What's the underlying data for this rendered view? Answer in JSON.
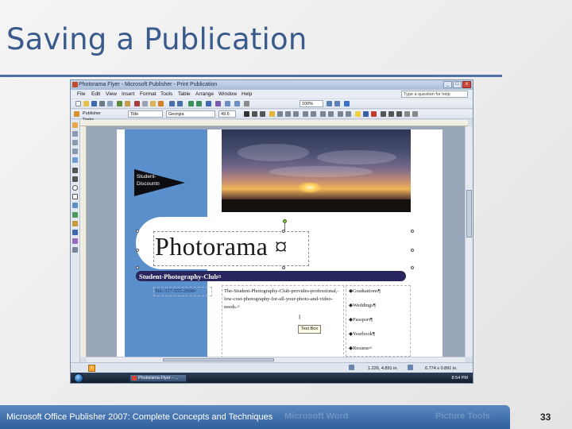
{
  "slide": {
    "title": "Saving a Publication",
    "footer": "Microsoft Office Publisher 2007: Complete Concepts and Techniques",
    "page_number": "33",
    "footer_ghost_1": "Microsoft Word",
    "footer_ghost_2": "Picture Tools"
  },
  "window": {
    "title": "Photorama Flyer - Microsoft Publisher - Print Publication",
    "minimize": "_",
    "maximize": "□",
    "close": "x"
  },
  "menu": [
    "File",
    "Edit",
    "View",
    "Insert",
    "Format",
    "Tools",
    "Table",
    "Arrange",
    "Window",
    "Help"
  ],
  "help_placeholder": "Type a question for help",
  "toolbar": {
    "zoom": "100%",
    "task_pane": "Publisher Tasks",
    "style": "Title",
    "font": "Georgia",
    "size": "49.6"
  },
  "publication": {
    "pennant_line1": "Student-",
    "pennant_line2": "Discount¤",
    "logo": "Photorama ¤",
    "club": "Student-Photography-Club¤",
    "tel": "Tel:-317-555-2008¤",
    "body": "The-Student-Photography-Club-provides-professional,-low-cost-photography-for-all-your-photo-and-video-needs.¤",
    "list": [
      "◆Graduations¶",
      "◆Weddings¶",
      "◆Passport¶",
      "◆Yearbook¶",
      "◆Resume¤"
    ],
    "tooltip": "Text Box",
    "cursor": "I"
  },
  "status": {
    "page": "1",
    "position": "1.226, 4.891 in.",
    "size": "6.774 x 0.891 in."
  },
  "taskbar": {
    "task": "Photorama Flyer - ...",
    "clock": "8:54 PM"
  },
  "colors": {
    "title": "#3a5a8c",
    "footer_bar": "#2f5f9e",
    "blue_column": "#5b8fcb",
    "club_bar": "#28265e"
  }
}
